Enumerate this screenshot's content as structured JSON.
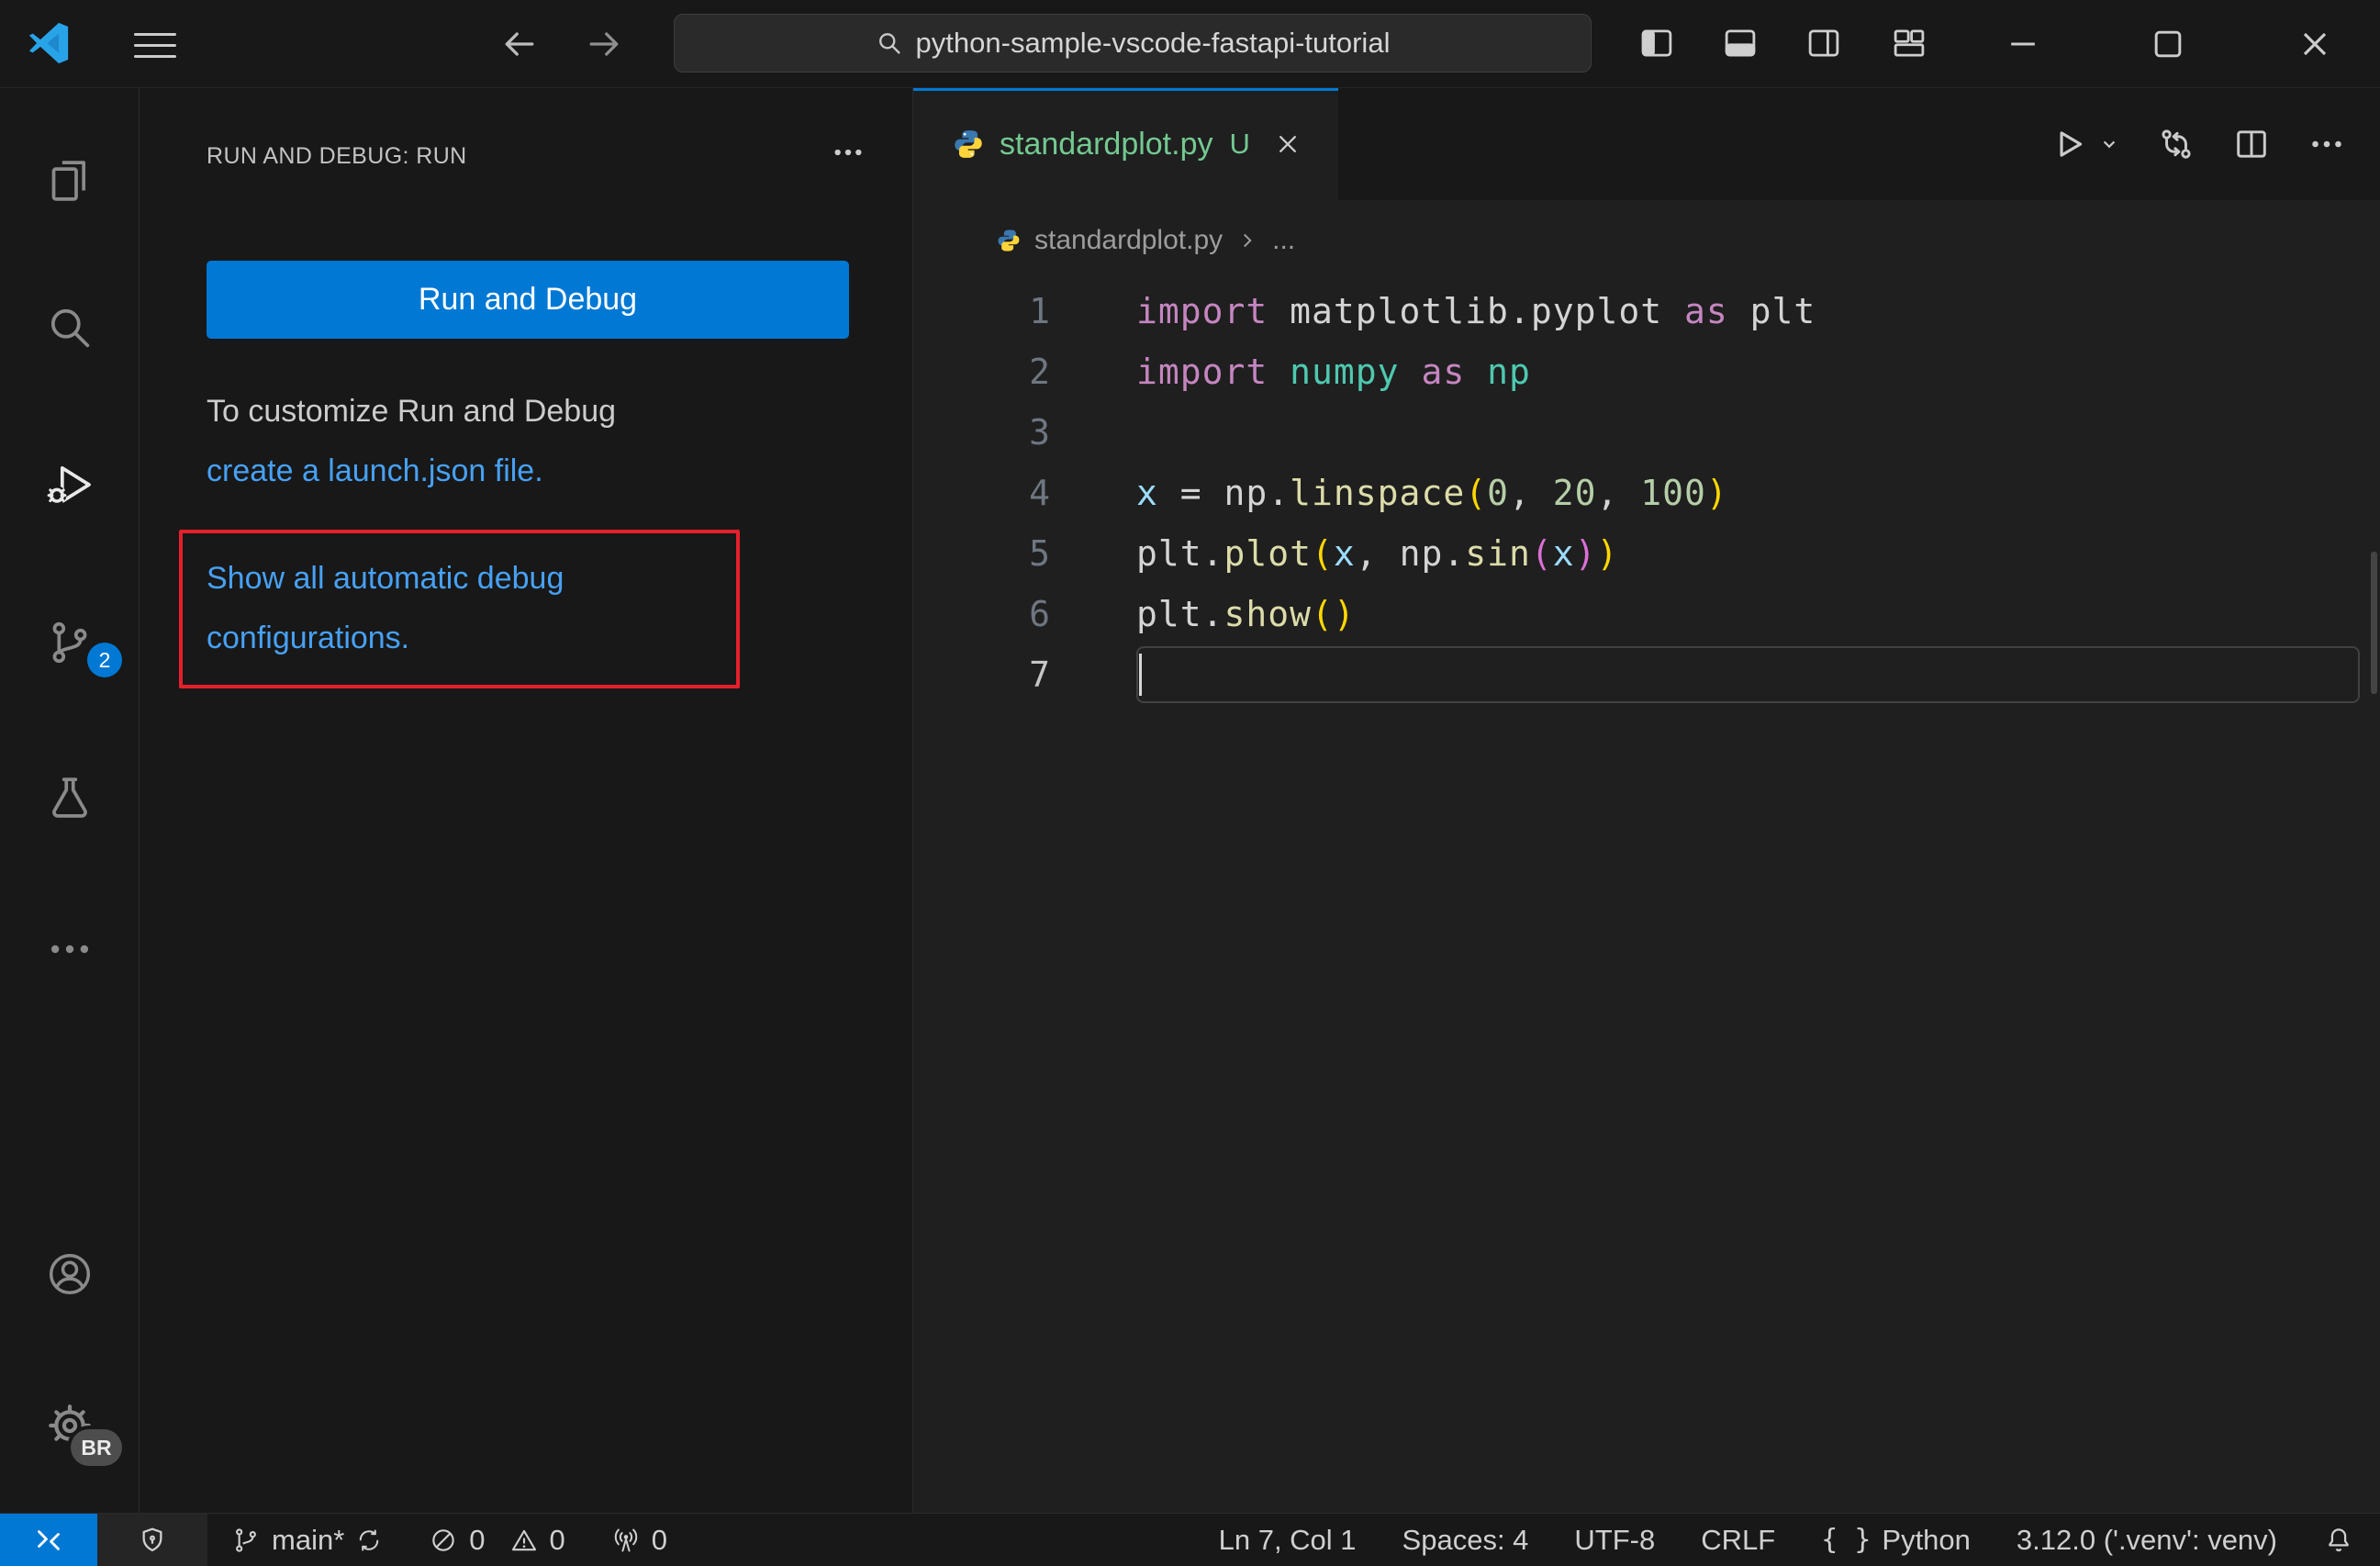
{
  "title_bar": {
    "command_center_text": "python-sample-vscode-fastapi-tutorial"
  },
  "activity_bar": {
    "source_control_badge": "2",
    "profile_badge": "BR"
  },
  "side_bar": {
    "title": "RUN AND DEBUG: RUN",
    "run_and_debug_button": "Run and Debug",
    "customize_text": "To customize Run and Debug",
    "launch_json_link": "create a launch.json file.",
    "auto_debug_link_line1": "Show all automatic debug",
    "auto_debug_link_line2": "configurations."
  },
  "editor": {
    "tab_label": "standardplot.py",
    "tab_git_status": "U",
    "breadcrumb_file": "standardplot.py",
    "breadcrumb_symbol": "...",
    "code": {
      "colors": {
        "keyword": "#C586C0",
        "plain": "#D4D4D4",
        "module": "#4EC9B0",
        "function": "#DCDCAA",
        "variable": "#9CDCFE",
        "number": "#B5CEA8",
        "bracket1": "#FFD700",
        "bracket2": "#DA70D6"
      },
      "lines": [
        {
          "num": "1",
          "tokens": [
            {
              "t": "import",
              "c": "keyword"
            },
            {
              "t": " matplotlib.pyplot ",
              "c": "plain"
            },
            {
              "t": "as",
              "c": "keyword"
            },
            {
              "t": " plt",
              "c": "plain"
            }
          ]
        },
        {
          "num": "2",
          "tokens": [
            {
              "t": "import",
              "c": "keyword"
            },
            {
              "t": " ",
              "c": "plain"
            },
            {
              "t": "numpy",
              "c": "module"
            },
            {
              "t": " ",
              "c": "plain"
            },
            {
              "t": "as",
              "c": "keyword"
            },
            {
              "t": " ",
              "c": "plain"
            },
            {
              "t": "np",
              "c": "module"
            }
          ]
        },
        {
          "num": "3",
          "tokens": []
        },
        {
          "num": "4",
          "tokens": [
            {
              "t": "x",
              "c": "variable"
            },
            {
              "t": " = np.",
              "c": "plain"
            },
            {
              "t": "linspace",
              "c": "function"
            },
            {
              "t": "(",
              "c": "bracket1"
            },
            {
              "t": "0",
              "c": "number"
            },
            {
              "t": ", ",
              "c": "plain"
            },
            {
              "t": "20",
              "c": "number"
            },
            {
              "t": ", ",
              "c": "plain"
            },
            {
              "t": "100",
              "c": "number"
            },
            {
              "t": ")",
              "c": "bracket1"
            }
          ]
        },
        {
          "num": "5",
          "tokens": [
            {
              "t": "plt.",
              "c": "plain"
            },
            {
              "t": "plot",
              "c": "function"
            },
            {
              "t": "(",
              "c": "bracket1"
            },
            {
              "t": "x",
              "c": "variable"
            },
            {
              "t": ", np.",
              "c": "plain"
            },
            {
              "t": "sin",
              "c": "function"
            },
            {
              "t": "(",
              "c": "bracket2"
            },
            {
              "t": "x",
              "c": "variable"
            },
            {
              "t": ")",
              "c": "bracket2"
            },
            {
              "t": ")",
              "c": "bracket1"
            }
          ]
        },
        {
          "num": "6",
          "tokens": [
            {
              "t": "plt.",
              "c": "plain"
            },
            {
              "t": "show",
              "c": "function"
            },
            {
              "t": "(",
              "c": "bracket1"
            },
            {
              "t": ")",
              "c": "bracket1"
            }
          ]
        },
        {
          "num": "7",
          "tokens": [],
          "current": true
        }
      ]
    }
  },
  "status_bar": {
    "branch": "main*",
    "error_count": "0",
    "warning_count": "0",
    "port_count": "0",
    "cursor_position": "Ln 7, Col 1",
    "indentation": "Spaces: 4",
    "encoding": "UTF-8",
    "line_ending": "CRLF",
    "language_icon": "{ }",
    "language": "Python",
    "interpreter": "3.12.0 ('.venv': venv)"
  },
  "colors": {
    "accent_blue": "#0078d4",
    "link_blue": "#47a1f5",
    "annotation_red": "#e5202c",
    "untracked_green": "#73C991"
  }
}
